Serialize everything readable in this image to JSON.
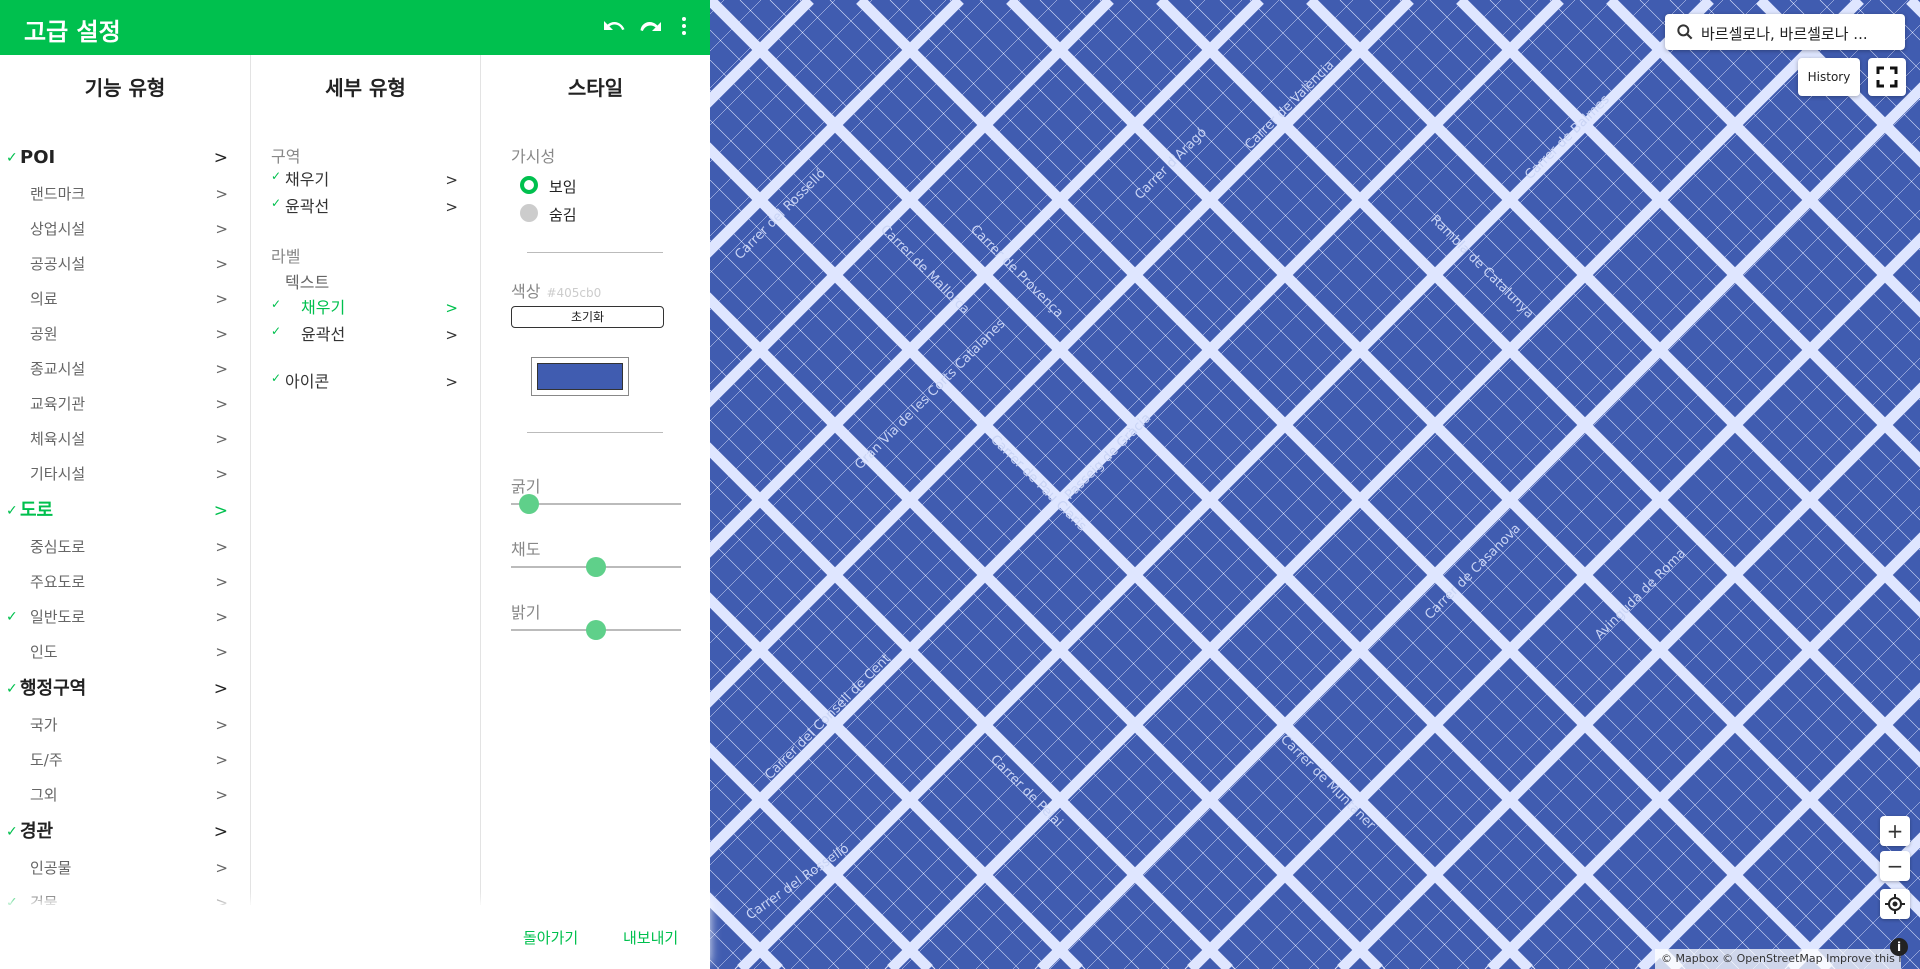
{
  "header": {
    "title": "고급 설정",
    "undo_icon": "undo-icon",
    "redo_icon": "redo-icon",
    "more_icon": "more-vert-icon"
  },
  "columns": {
    "feature_type": "기능 유형",
    "sub_type": "세부 유형",
    "style": "스타일"
  },
  "feature_types": [
    {
      "label": "POI",
      "checked": true,
      "level": "category",
      "arrow": ">"
    },
    {
      "label": "랜드마크",
      "checked": false,
      "level": "sub",
      "arrow": ">"
    },
    {
      "label": "상업시설",
      "checked": false,
      "level": "sub",
      "arrow": ">"
    },
    {
      "label": "공공시설",
      "checked": false,
      "level": "sub",
      "arrow": ">"
    },
    {
      "label": "의료",
      "checked": false,
      "level": "sub",
      "arrow": ">"
    },
    {
      "label": "공원",
      "checked": false,
      "level": "sub",
      "arrow": ">"
    },
    {
      "label": "종교시설",
      "checked": false,
      "level": "sub",
      "arrow": ">"
    },
    {
      "label": "교육기관",
      "checked": false,
      "level": "sub",
      "arrow": ">"
    },
    {
      "label": "체육시설",
      "checked": false,
      "level": "sub",
      "arrow": ">"
    },
    {
      "label": "기타시설",
      "checked": false,
      "level": "sub",
      "arrow": ">"
    },
    {
      "label": "도로",
      "checked": true,
      "level": "category",
      "active": true,
      "arrow": ">"
    },
    {
      "label": "중심도로",
      "checked": false,
      "level": "sub",
      "arrow": ">"
    },
    {
      "label": "주요도로",
      "checked": false,
      "level": "sub",
      "arrow": ">"
    },
    {
      "label": "일반도로",
      "checked": true,
      "level": "sub",
      "arrow": ">"
    },
    {
      "label": "인도",
      "checked": false,
      "level": "sub",
      "arrow": ">"
    },
    {
      "label": "행정구역",
      "checked": true,
      "level": "category",
      "arrow": ">"
    },
    {
      "label": "국가",
      "checked": false,
      "level": "sub",
      "arrow": ">"
    },
    {
      "label": "도/주",
      "checked": false,
      "level": "sub",
      "arrow": ">"
    },
    {
      "label": "그외",
      "checked": false,
      "level": "sub",
      "arrow": ">"
    },
    {
      "label": "경관",
      "checked": true,
      "level": "category",
      "arrow": ">"
    },
    {
      "label": "인공물",
      "checked": false,
      "level": "sub",
      "arrow": ">"
    },
    {
      "label": "건물",
      "checked": true,
      "level": "sub",
      "arrow": ">"
    }
  ],
  "sub_types": {
    "area_heading": "구역",
    "area_fill": "채우기",
    "area_outline": "윤곽선",
    "label_heading": "라벨",
    "text_heading": "텍스트",
    "text_fill": "채우기",
    "text_outline": "윤곽선",
    "icon": "아이콘",
    "arrow": ">"
  },
  "style": {
    "visibility_label": "가시성",
    "visible": "보임",
    "hidden": "숨김",
    "color_label": "색상",
    "color_hex": "#405cb0",
    "reset": "초기화",
    "swatch_color": "#405cb0",
    "weight_label": "굵기",
    "saturation_label": "채도",
    "lightness_label": "밝기",
    "weight_value": 0.05,
    "saturation_value": 0.5,
    "lightness_value": 0.5
  },
  "footer": {
    "back": "돌아가기",
    "export": "내보내기"
  },
  "map": {
    "search_text": "바르셀로나, 바르셀로나 ...",
    "search_icon": "search-icon",
    "history": "History",
    "fullscreen_icon": "fullscreen-icon",
    "zoom_in": "+",
    "zoom_out": "−",
    "locate_icon": "locate-icon",
    "attribution": "© Mapbox © OpenStreetMap Improve this map",
    "info": "i",
    "background": "#405cb0",
    "streets": [
      "Carrer del Rosselló",
      "Carrer de Mallorca",
      "Carrer de Provença",
      "Carrer d'Aragó",
      "Carrer de València",
      "Rambla de Catalunya",
      "Carrer de Balmes",
      "Gran Via de les Corts Catalanes",
      "Carrer de Pau Claris",
      "Passeig de Gràcia",
      "Carrer de Muntaner",
      "Carrer de Casanova",
      "Avinguda de Roma",
      "Carrer del Consell de Cent",
      "Carrer de Pelai"
    ]
  }
}
